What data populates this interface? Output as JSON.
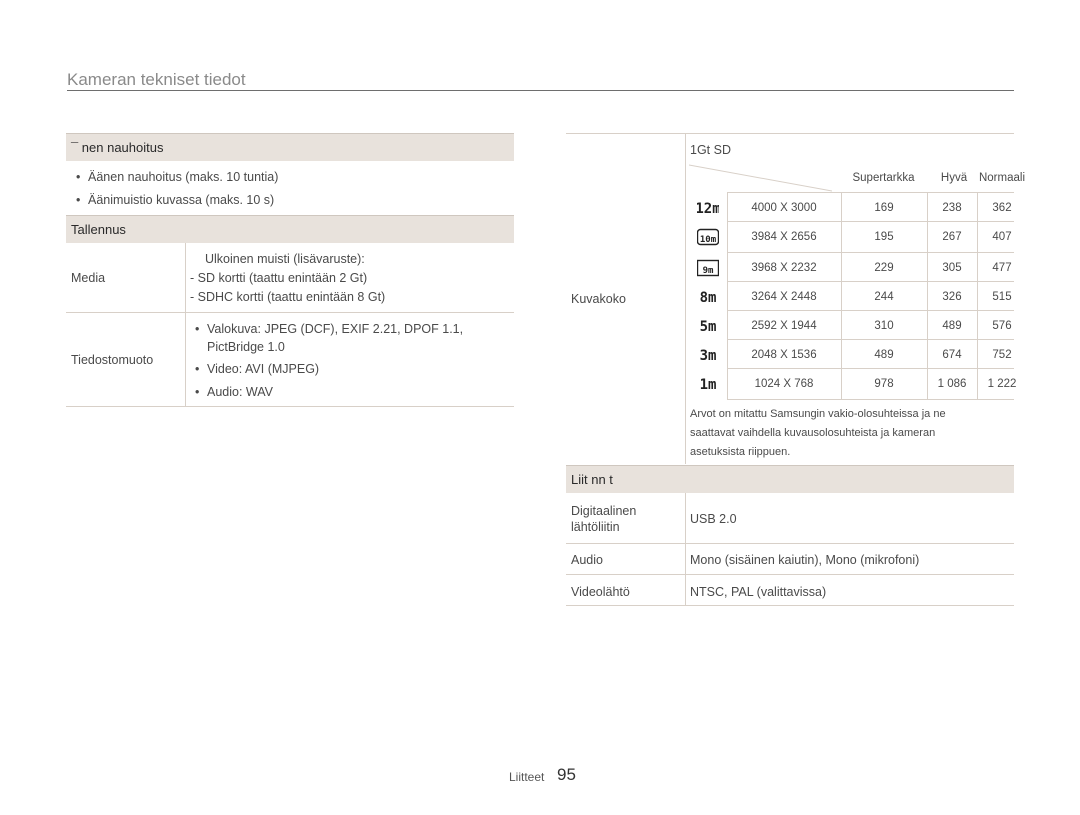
{
  "page_title": "Kameran tekniset tiedot",
  "sound_recording": {
    "header": "¯ nen nauhoitus",
    "bullets": [
      "Äänen nauhoitus (maks. 10 tuntia)",
      "Äänimuistio kuvassa (maks. 10 s)"
    ]
  },
  "storage": {
    "header": "Tallennus",
    "media_label": "Media",
    "media_lines": [
      "Ulkoinen muisti (lisävaruste):",
      "-  SD kortti (taattu enintään 2 Gt)",
      "-  SDHC kortti (taattu enintään 8 Gt)"
    ],
    "format_label": "Tiedostomuoto",
    "format_lines": [
      "Valokuva: JPEG (DCF), EXIF 2.21, DPOF 1.1,",
      "PictBridge 1.0",
      "Video: AVI (MJPEG)",
      "Audio: WAV"
    ]
  },
  "image_size": {
    "row_label": "Kuvakoko",
    "card": "1Gt SD",
    "columns": [
      "Supertarkka",
      "Hyvä",
      "Normaali"
    ],
    "rows": [
      {
        "icon": "12m-icon",
        "glyph": "12m",
        "resolution": "4000 X 3000",
        "values": [
          "169",
          "238",
          "362"
        ]
      },
      {
        "icon": "10m-icon",
        "glyph": "10m",
        "resolution": "3984 X 2656",
        "values": [
          "195",
          "267",
          "407"
        ]
      },
      {
        "icon": "9m-icon",
        "glyph": "9m",
        "resolution": "3968 X 2232",
        "values": [
          "229",
          "305",
          "477"
        ]
      },
      {
        "icon": "8m-icon",
        "glyph": "8m",
        "resolution": "3264 X 2448",
        "values": [
          "244",
          "326",
          "515"
        ]
      },
      {
        "icon": "5m-icon",
        "glyph": "5m",
        "resolution": "2592 X 1944",
        "values": [
          "310",
          "489",
          "576"
        ]
      },
      {
        "icon": "3m-icon",
        "glyph": "3m",
        "resolution": "2048 X 1536",
        "values": [
          "489",
          "674",
          "752"
        ]
      },
      {
        "icon": "1m-icon",
        "glyph": "1m",
        "resolution": "1024 X 768",
        "values": [
          "978",
          "1 086",
          "1 222"
        ]
      }
    ],
    "note_lines": [
      "Arvot on mitattu Samsungin vakio-olosuhteissa ja ne",
      "saattavat vaihdella kuvausolosuhteista ja kameran",
      "asetuksista riippuen."
    ]
  },
  "connections": {
    "header": "Liit nn t",
    "rows": [
      {
        "label_lines": [
          "Digitaalinen",
          "lähtöliitin"
        ],
        "value": "USB 2.0"
      },
      {
        "label_lines": [
          "Audio"
        ],
        "value": "Mono (sisäinen kaiutin), Mono (mikrofoni)"
      },
      {
        "label_lines": [
          "Videolähtö"
        ],
        "value": "NTSC, PAL (valittavissa)"
      }
    ]
  },
  "footer": {
    "label": "Liitteet",
    "page": "95"
  }
}
